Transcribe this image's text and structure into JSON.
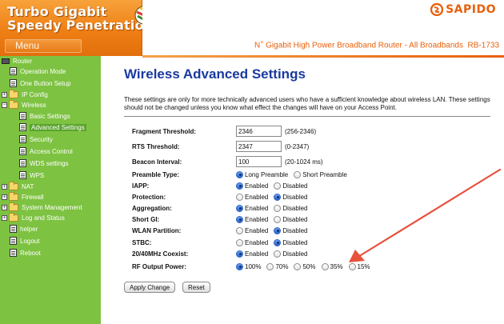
{
  "brand": {
    "title": "Turbo Gigabit\nSpeedy Penetration",
    "menu_label": "Menu",
    "logo_name": "sapido-balloon-icon",
    "company": "SAPIDO",
    "tagline_prefix": "N",
    "tagline_sup": "+",
    "tagline_text": "Gigabit High Power Broadband Router - All Broadbands",
    "model": "RB-1733"
  },
  "sidebar": {
    "items": [
      {
        "label": "Router",
        "icon": "router-icon"
      },
      {
        "label": "Operation Mode",
        "icon": "page-icon"
      },
      {
        "label": "One Button Setup",
        "icon": "page-icon"
      },
      {
        "label": "IP Config",
        "icon": "folder-icon"
      },
      {
        "label": "Wireless",
        "icon": "folder-icon"
      },
      {
        "label": "Basic Settings",
        "icon": "page-icon"
      },
      {
        "label": "Advanced Settings",
        "icon": "page-icon"
      },
      {
        "label": "Security",
        "icon": "page-icon"
      },
      {
        "label": "Access Control",
        "icon": "page-icon"
      },
      {
        "label": "WDS settings",
        "icon": "page-icon"
      },
      {
        "label": "WPS",
        "icon": "page-icon"
      },
      {
        "label": "NAT",
        "icon": "folder-icon"
      },
      {
        "label": "Firewall",
        "icon": "folder-icon"
      },
      {
        "label": "System Management",
        "icon": "folder-icon"
      },
      {
        "label": "Log and Status",
        "icon": "folder-icon"
      },
      {
        "label": "helper",
        "icon": "page-icon"
      },
      {
        "label": "Logout",
        "icon": "page-icon"
      },
      {
        "label": "Reboot",
        "icon": "page-icon"
      }
    ]
  },
  "main": {
    "title": "Wireless Advanced Settings",
    "description": "These settings are only for more technically advanced users who have a sufficient knowledge about wireless LAN. These settings should not be changed unless you know what effect the changes will have on your Access Point.",
    "fields": {
      "fragment": {
        "label": "Fragment Threshold:",
        "value": "2346",
        "hint": "(256-2346)"
      },
      "rts": {
        "label": "RTS Threshold:",
        "value": "2347",
        "hint": "(0-2347)"
      },
      "beacon": {
        "label": "Beacon Interval:",
        "value": "100",
        "hint": "(20-1024 ms)"
      }
    },
    "radios": {
      "preamble": {
        "label": "Preamble Type:",
        "options": [
          "Long Preamble",
          "Short Preamble"
        ],
        "selected": 0
      },
      "iapp": {
        "label": "IAPP:",
        "options": [
          "Enabled",
          "Disabled"
        ],
        "selected": 0
      },
      "protection": {
        "label": "Protection:",
        "options": [
          "Enabled",
          "Disabled"
        ],
        "selected": 1
      },
      "aggregation": {
        "label": "Aggregation:",
        "options": [
          "Enabled",
          "Disabled"
        ],
        "selected": 0
      },
      "shortgi": {
        "label": "Short GI:",
        "options": [
          "Enabled",
          "Disabled"
        ],
        "selected": 0
      },
      "wlanpart": {
        "label": "WLAN Partition:",
        "options": [
          "Enabled",
          "Disabled"
        ],
        "selected": 1
      },
      "stbc": {
        "label": "STBC:",
        "options": [
          "Enabled",
          "Disabled"
        ],
        "selected": 1
      },
      "coexist": {
        "label": "20/40MHz Coexist:",
        "options": [
          "Enabled",
          "Disabled"
        ],
        "selected": 0
      },
      "rfpower": {
        "label": "RF Output Power:",
        "options": [
          "100%",
          "70%",
          "50%",
          "35%",
          "15%"
        ],
        "selected": 0
      }
    },
    "buttons": {
      "apply": "Apply Change",
      "reset": "Reset"
    }
  },
  "colors": {
    "sidebar_bg": "#7dc241",
    "brand_orange": "#ef7f15",
    "title_blue": "#1a3aa0",
    "arrow_red": "#e8513c"
  }
}
